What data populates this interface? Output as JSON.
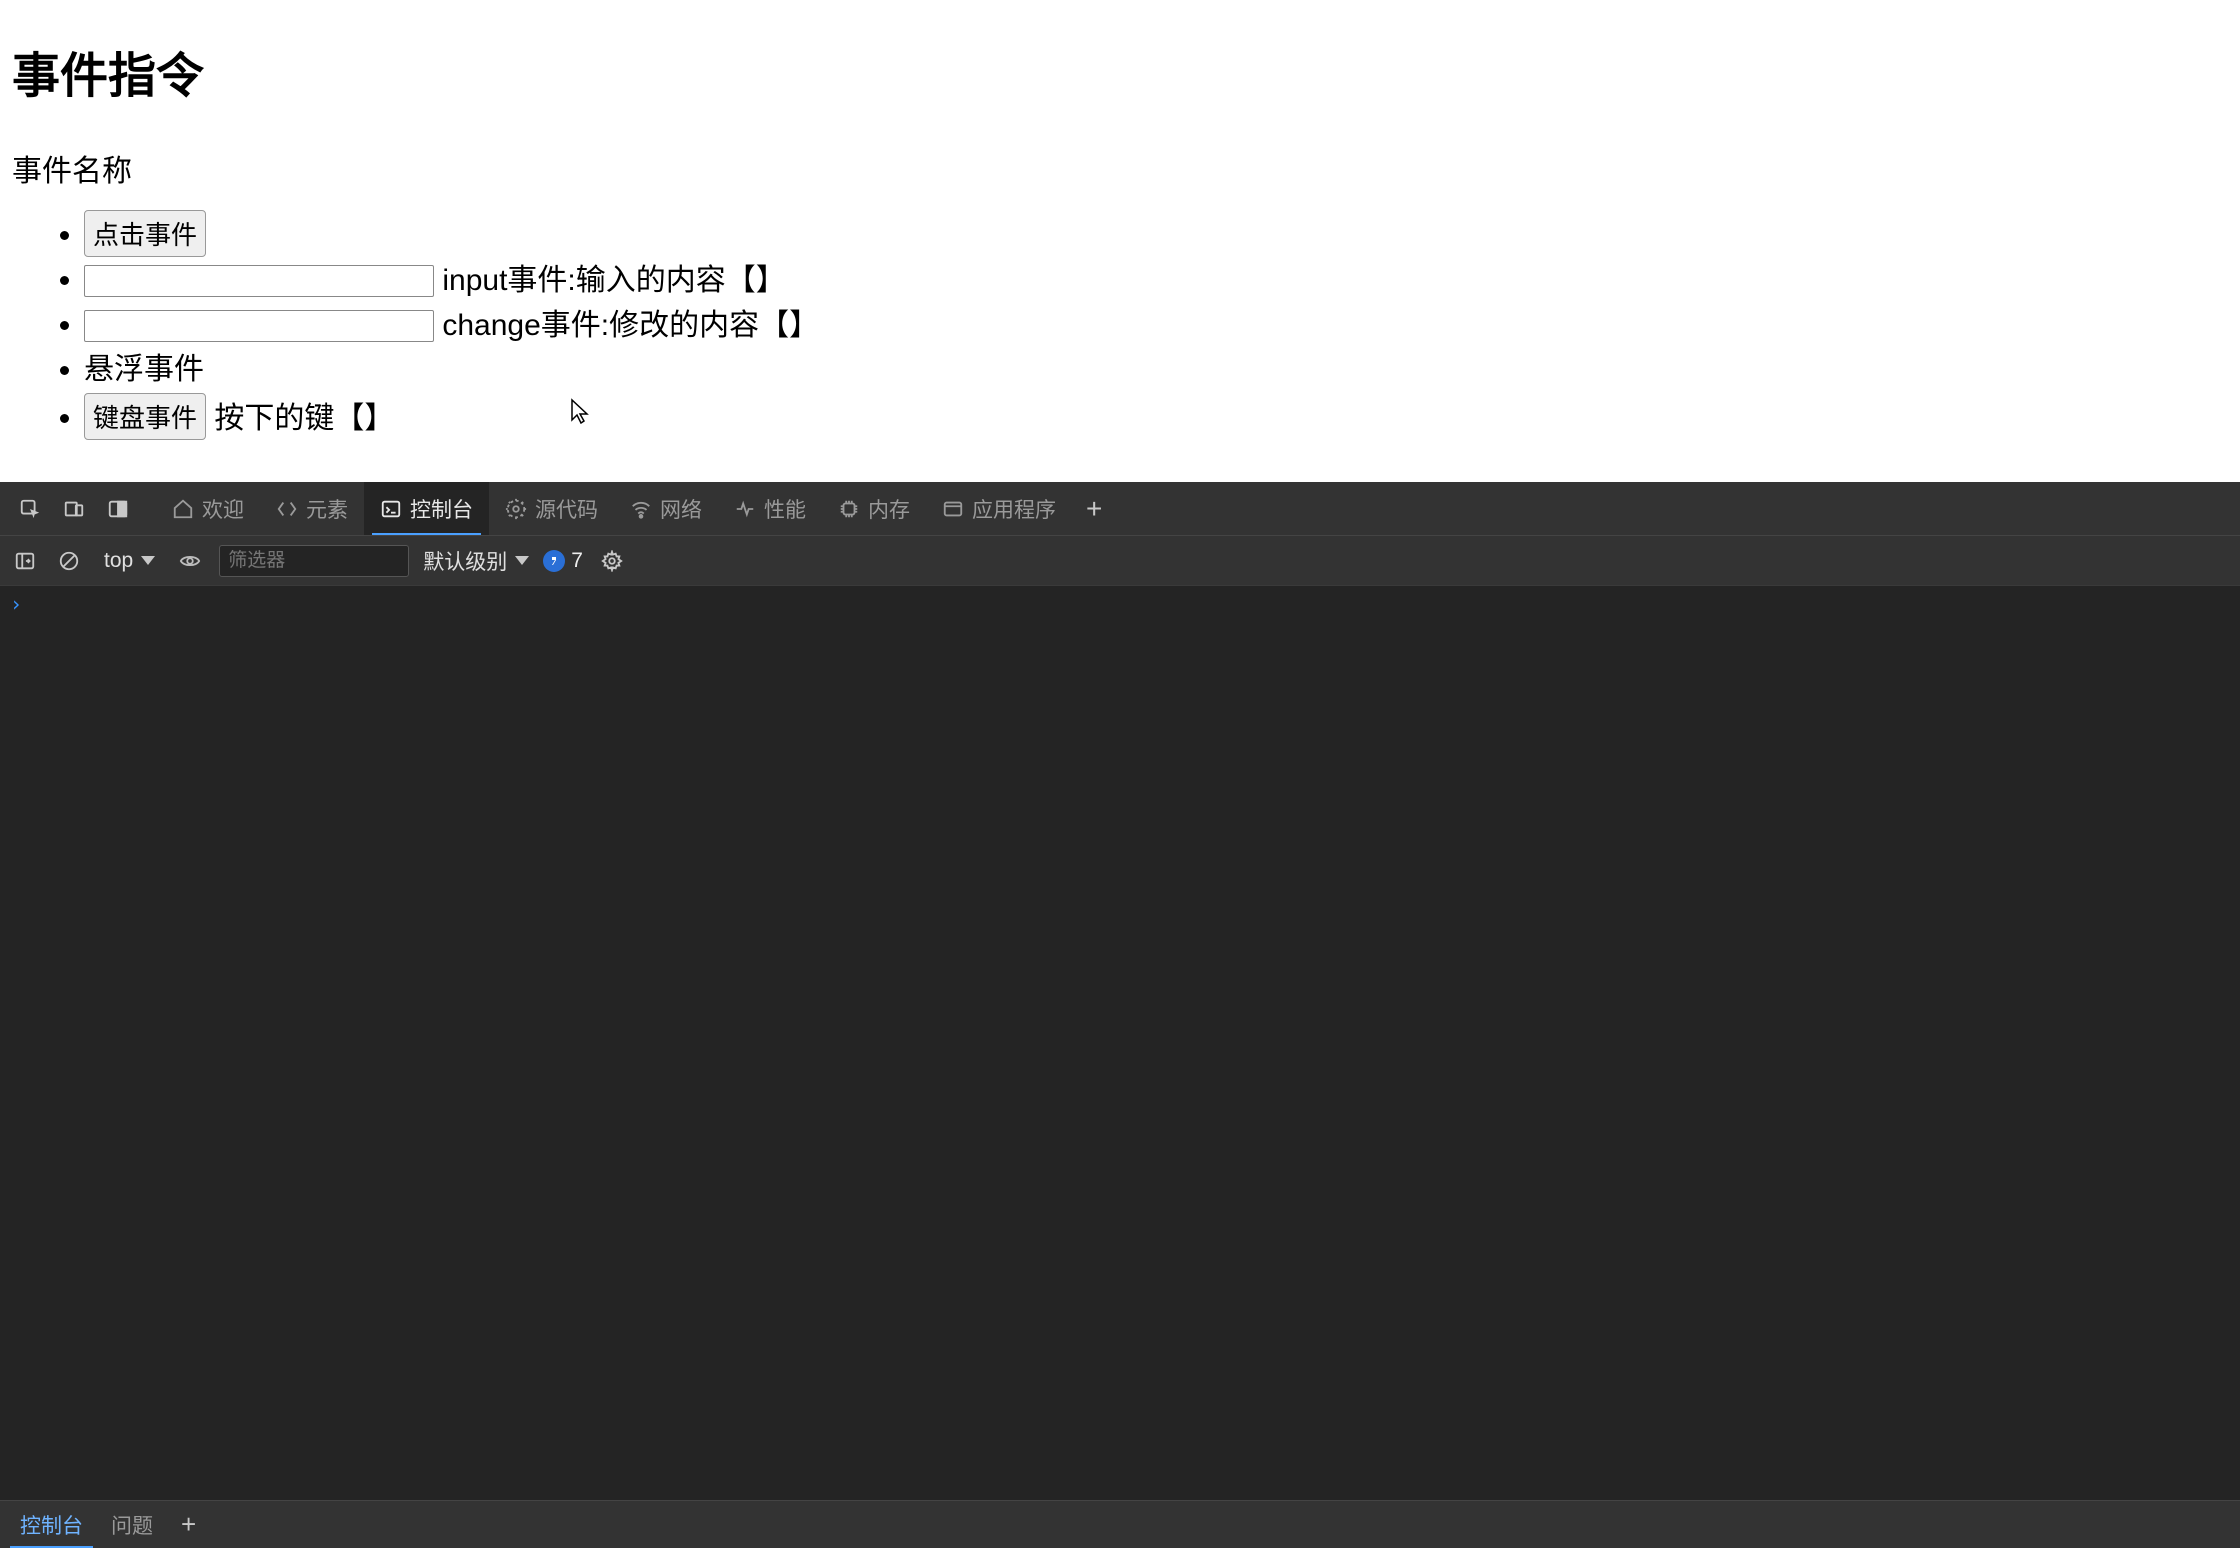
{
  "page": {
    "heading": "事件指令",
    "subtitle": "事件名称",
    "items": {
      "click_button": "点击事件",
      "input_label": "input事件:输入的内容【】",
      "change_label": "change事件:修改的内容【】",
      "hover_label": "悬浮事件",
      "keyboard_button": "键盘事件",
      "keyboard_suffix": "按下的键【】"
    }
  },
  "devtools": {
    "tabs": {
      "welcome": "欢迎",
      "elements": "元素",
      "console": "控制台",
      "sources": "源代码",
      "network": "网络",
      "performance": "性能",
      "memory": "内存",
      "application": "应用程序"
    },
    "toolbar": {
      "context": "top",
      "filter_placeholder": "筛选器",
      "level": "默认级别",
      "issue_count": "7"
    },
    "drawer": {
      "console": "控制台",
      "issues": "问题"
    }
  }
}
